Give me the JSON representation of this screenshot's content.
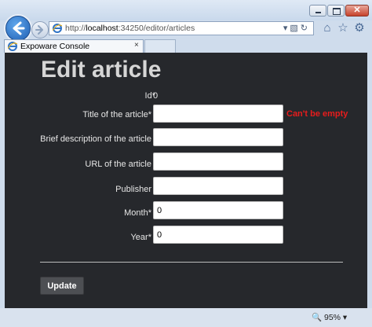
{
  "browser": {
    "url_prefix": "http://",
    "url_host": "localhost",
    "url_rest": ":34250/editor/articles",
    "tab_title": "Expoware Console",
    "zoom": "95%",
    "close_glyph": "✕",
    "tab_close_glyph": "×"
  },
  "page": {
    "title": "Edit article",
    "fields": {
      "id": {
        "label": "Id*",
        "value": "0"
      },
      "title": {
        "label": "Title of the article*",
        "value": "",
        "error": "Can't be empty"
      },
      "description": {
        "label": "Brief description of the article",
        "value": ""
      },
      "url": {
        "label": "URL of the article",
        "value": ""
      },
      "publisher": {
        "label": "Publisher",
        "value": ""
      },
      "month": {
        "label": "Month*",
        "value": "0"
      },
      "year": {
        "label": "Year*",
        "value": "0"
      }
    },
    "update_label": "Update"
  },
  "colors": {
    "background": "#26282c",
    "error": "#e81c1c",
    "accent": "#1f5fb3"
  },
  "icons": [
    "back-arrow-icon",
    "forward-arrow-icon",
    "ie-icon",
    "search-dropdown-icon",
    "compat-icon",
    "refresh-icon",
    "home-icon",
    "favorites-icon",
    "gear-icon",
    "zoom-icon"
  ]
}
